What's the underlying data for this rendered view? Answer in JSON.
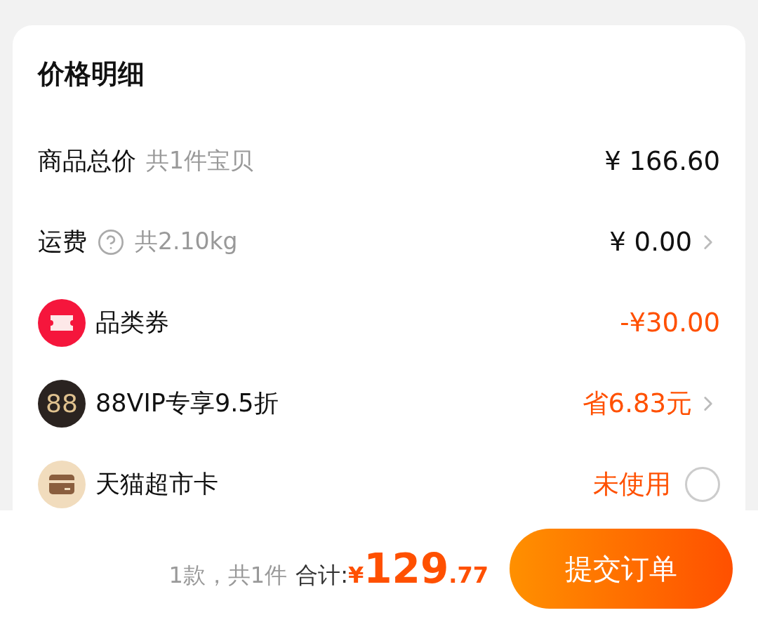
{
  "price_detail": {
    "title": "价格明细",
    "rows": [
      {
        "kind": "plain",
        "label": "商品总价",
        "note": "共1件宝贝",
        "value": "¥ 166.60",
        "highlight": false,
        "chevron": false
      },
      {
        "kind": "help",
        "label": "运费",
        "note": "共2.10kg",
        "value": "¥ 0.00",
        "highlight": false,
        "chevron": true
      },
      {
        "kind": "coupon",
        "label": "品类券",
        "value": "-¥30.00",
        "highlight": true,
        "chevron": false
      },
      {
        "kind": "vip",
        "badge": "88",
        "label": "88VIP专享9.5折",
        "value": "省6.83元",
        "highlight": true,
        "chevron": true
      },
      {
        "kind": "card",
        "label": "天猫超市卡",
        "value": "未使用",
        "highlight": true,
        "chevron": false,
        "checked": false
      }
    ]
  },
  "footer": {
    "count": "1款，共1件",
    "total_label": "合计:",
    "currency": "¥",
    "total_main": "129",
    "total_decimal": ".77",
    "submit": "提交订单"
  }
}
